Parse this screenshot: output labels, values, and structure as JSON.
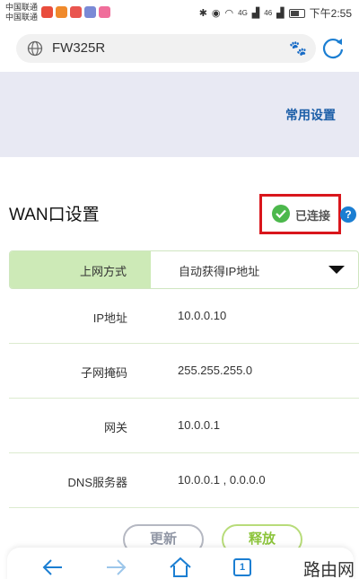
{
  "status_bar": {
    "carrier_1": "中国联通",
    "carrier_2": "中国联通",
    "signal_label_1": "4G",
    "signal_label_2": "46",
    "time": "下午2:55"
  },
  "browser": {
    "url": "FW325R",
    "icons": [
      "globe-icon",
      "paw-icon",
      "refresh-icon"
    ]
  },
  "banner": {
    "common_settings": "常用设置"
  },
  "wan": {
    "title": "WAN口设置",
    "status": "已连接",
    "help_glyph": "?",
    "status_color": "#4cb84c"
  },
  "form": {
    "connection_type": {
      "label": "上网方式",
      "value": "自动获得IP地址"
    },
    "rows": [
      {
        "label": "IP地址",
        "value": "10.0.0.10"
      },
      {
        "label": "子网掩码",
        "value": "255.255.255.0"
      },
      {
        "label": "网关",
        "value": "10.0.0.1"
      },
      {
        "label": "DNS服务器",
        "value": "10.0.0.1 , 0.0.0.0"
      }
    ]
  },
  "buttons": {
    "update": "更新",
    "release": "释放"
  },
  "bottom_nav": {
    "tab_count": "1",
    "icons": [
      "back-arrow-icon",
      "forward-arrow-icon",
      "home-icon",
      "tabs-icon"
    ]
  },
  "watermark": "路由网",
  "colors": {
    "accent_blue": "#1d5fa8",
    "highlight_red": "#d9161c",
    "green": "#8cc43b",
    "banner_bg": "#e8e9f3"
  }
}
